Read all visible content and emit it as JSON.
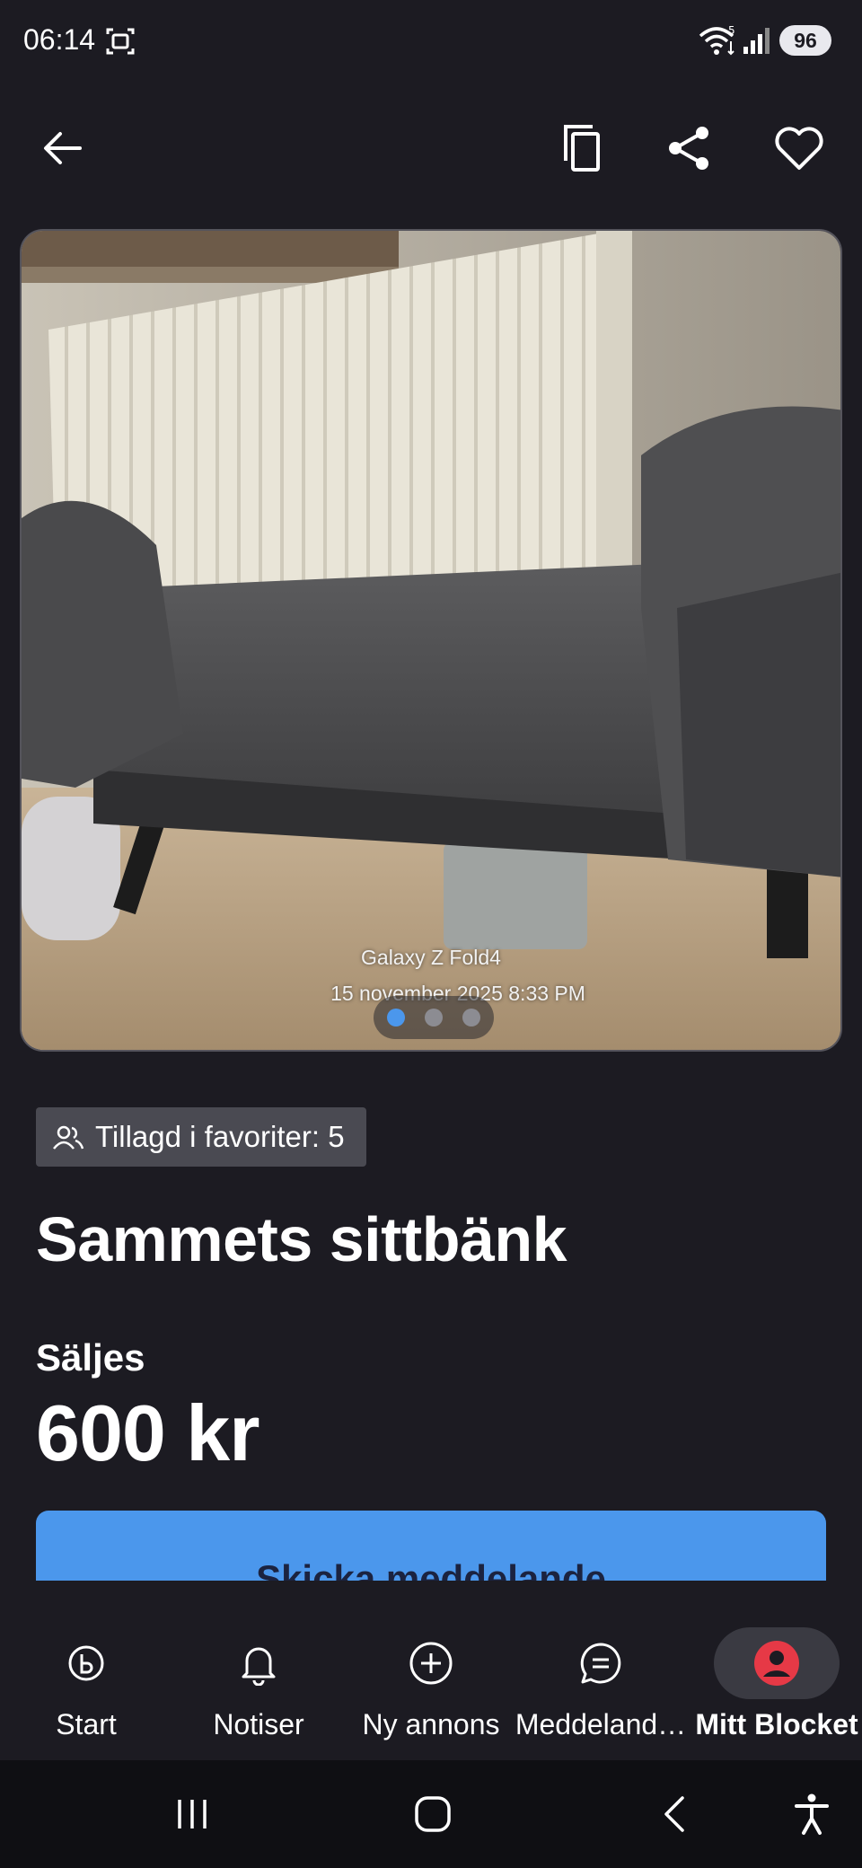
{
  "status_bar": {
    "time": "06:14",
    "network": "5",
    "battery": "96",
    "icons": [
      "screenshot-icon",
      "wifi-icon",
      "signal-icon"
    ]
  },
  "top_bar": {
    "icons": [
      "back-arrow-icon",
      "copy-icon",
      "share-icon",
      "heart-icon"
    ]
  },
  "gallery": {
    "watermark_line1": "Galaxy Z Fold4",
    "watermark_line2": "15 november 2025 8:33 PM",
    "page_count": 3,
    "active_index": 0
  },
  "listing": {
    "favorites_badge": "Tillagd i favoriter: 5",
    "title": "Sammets sittbänk",
    "sale_type": "Säljes",
    "price": "600 kr",
    "cta_label": "Skicka meddelande"
  },
  "bottom_nav": {
    "items": [
      {
        "label": "Start",
        "icon": "blocket-logo-icon"
      },
      {
        "label": "Notiser",
        "icon": "bell-icon"
      },
      {
        "label": "Ny annons",
        "icon": "plus-circle-icon"
      },
      {
        "label": "Meddeland…",
        "icon": "chat-icon"
      },
      {
        "label": "Mitt Blocket",
        "icon": "account-icon"
      }
    ],
    "active": "Mitt Blocket"
  },
  "colors": {
    "background": "#1c1b22",
    "accent": "#4b97ec",
    "account_icon": "#e63946"
  }
}
